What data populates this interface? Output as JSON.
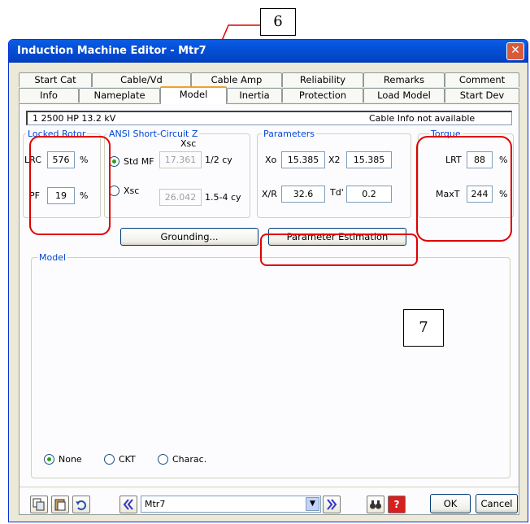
{
  "window": {
    "title": "Induction Machine Editor - Mtr7",
    "close_glyph": "✕"
  },
  "tabs_row1": [
    "Start Cat",
    "Cable/Vd",
    "Cable Amp",
    "Reliability",
    "Remarks",
    "Comment"
  ],
  "tabs_row2": [
    "Info",
    "Nameplate",
    "Model",
    "Inertia",
    "Protection",
    "Load Model",
    "Start Dev"
  ],
  "active_tab": "Model",
  "info_bar": {
    "left": "1   2500 HP  13.2 kV",
    "right": "Cable Info not available"
  },
  "locked_rotor": {
    "title": "Locked Rotor",
    "lrc_label": "LRC",
    "lrc_value": "576",
    "lrc_unit": "%",
    "pf_label": "PF",
    "pf_value": "19",
    "pf_unit": "%"
  },
  "ansi": {
    "title": "ANSI  Short-Circuit Z",
    "xsc_header": "Xsc",
    "std_mf_label": "Std MF",
    "std_mf_value": "17.361",
    "std_mf_unit": "1/2 cy",
    "xsc_label": "Xsc",
    "xsc_value": "26.042",
    "xsc_unit": "1.5-4 cy",
    "selected": "Std MF"
  },
  "parameters": {
    "title": "Parameters",
    "xo_label": "Xo",
    "xo_value": "15.385",
    "x2_label": "X2",
    "x2_value": "15.385",
    "xr_label": "X/R",
    "xr_value": "32.6",
    "td_label": "Td'",
    "td_value": "0.2"
  },
  "torque": {
    "title": "Torque",
    "lrt_label": "LRT",
    "lrt_value": "88",
    "lrt_unit": "%",
    "maxt_label": "MaxT",
    "maxt_value": "244",
    "maxt_unit": "%"
  },
  "buttons": {
    "grounding": "Grounding...",
    "param_est": "Parameter Estimation"
  },
  "model_group": {
    "title": "Model",
    "radio_none": "None",
    "radio_ckt": "CKT",
    "radio_charac": "Charac.",
    "selected": "None"
  },
  "bottom": {
    "record_value": "Mtr7",
    "ok_label": "OK",
    "cancel_label": "Cancel"
  },
  "callouts": {
    "six": "6",
    "seven": "7"
  },
  "colors": {
    "title_bar": "#0450d6",
    "group_label": "#0046d5",
    "highlight": "#e00000"
  }
}
